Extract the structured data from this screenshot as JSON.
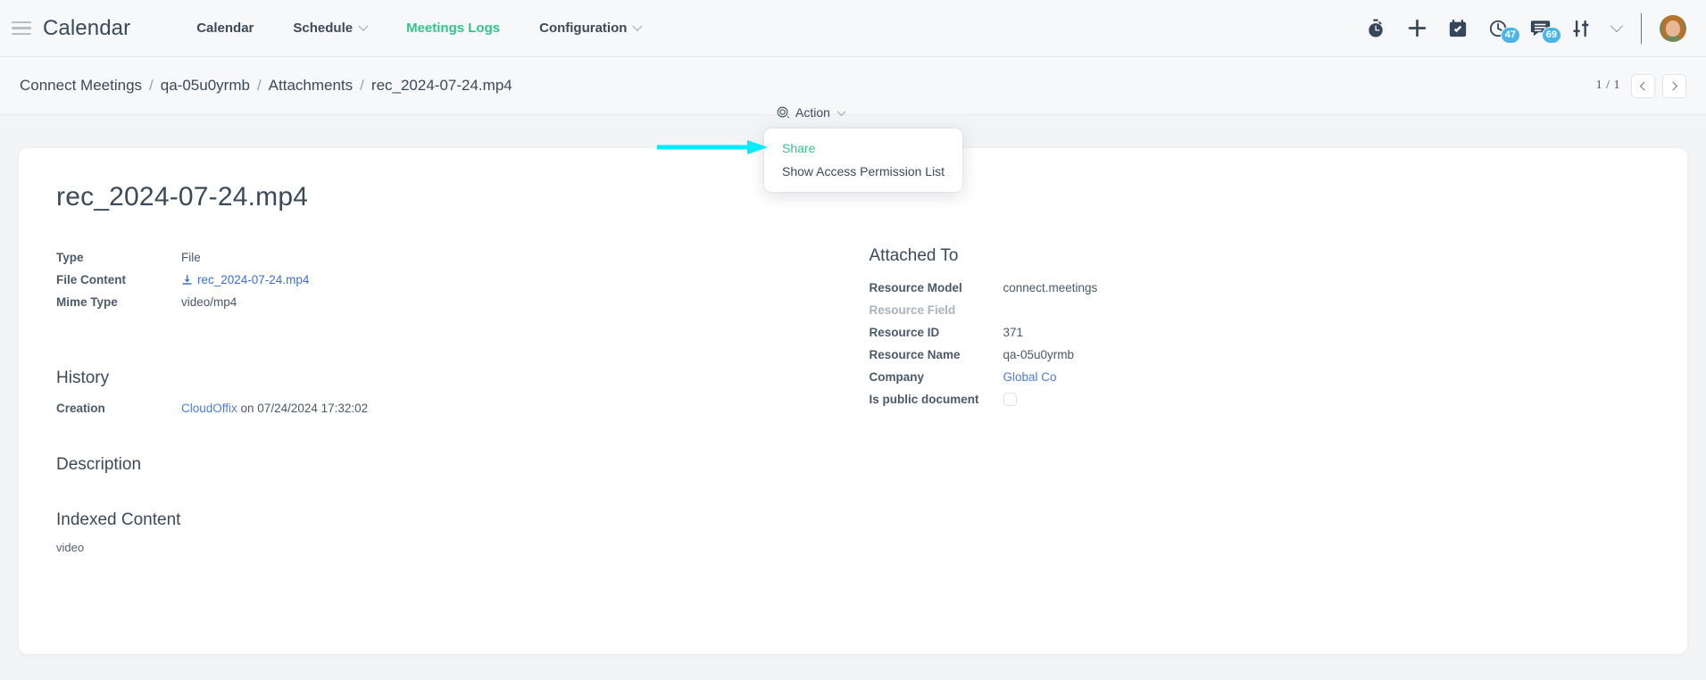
{
  "topbar": {
    "menu_icon": "hamburger-icon",
    "brand": "Calendar",
    "menu": [
      {
        "label": "Calendar",
        "has_caret": false,
        "active": false
      },
      {
        "label": "Schedule",
        "has_caret": true,
        "active": false
      },
      {
        "label": "Meetings Logs",
        "has_caret": false,
        "active": true
      },
      {
        "label": "Configuration",
        "has_caret": true,
        "active": false
      }
    ],
    "icons": [
      {
        "name": "stopwatch-icon",
        "badge": null
      },
      {
        "name": "plus-icon",
        "badge": null
      },
      {
        "name": "calendar-check-icon",
        "badge": null
      },
      {
        "name": "clock-activity-icon",
        "badge": "47"
      },
      {
        "name": "messages-icon",
        "badge": "69"
      },
      {
        "name": "sliders-icon",
        "badge": null
      }
    ],
    "chevron": "chevron-down-icon",
    "avatar": "user-avatar",
    "accent_color": "#31c48d",
    "badge_color": "#49b7e5"
  },
  "breadcrumb": {
    "items": [
      "Connect Meetings",
      "qa-05u0yrmb",
      "Attachments",
      "rec_2024-07-24.mp4"
    ],
    "separator": "/"
  },
  "pager": {
    "count": "1 / 1",
    "prev_icon": "chevron-left-icon",
    "next_icon": "chevron-right-icon"
  },
  "action": {
    "icon": "action-gear-icon",
    "label": "Action",
    "caret": "chevron-down-icon",
    "menu": [
      {
        "label": "Share",
        "highlighted": true
      },
      {
        "label": "Show Access Permission List",
        "highlighted": false
      }
    ]
  },
  "annotation": {
    "arrow_color": "#00ecff",
    "points_to": "Share"
  },
  "document": {
    "title": "rec_2024-07-24.mp4",
    "fields": [
      {
        "label": "Type",
        "value": "File",
        "kind": "text"
      },
      {
        "label": "File Content",
        "value": "rec_2024-07-24.mp4",
        "kind": "download-link"
      },
      {
        "label": "Mime Type",
        "value": "video/mp4",
        "kind": "text"
      }
    ]
  },
  "attached_to": {
    "title": "Attached To",
    "fields": [
      {
        "label": "Resource Model",
        "value": "connect.meetings",
        "kind": "text"
      },
      {
        "label": "Resource Field",
        "value": "",
        "kind": "empty"
      },
      {
        "label": "Resource ID",
        "value": "371",
        "kind": "text"
      },
      {
        "label": "Resource Name",
        "value": "qa-05u0yrmb",
        "kind": "text"
      },
      {
        "label": "Company",
        "value": "Global Co",
        "kind": "link"
      },
      {
        "label": "Is public document",
        "value": "",
        "kind": "checkbox",
        "checked": false
      }
    ]
  },
  "history": {
    "title": "History",
    "label": "Creation",
    "author": "CloudOffix",
    "rest": " on 07/24/2024 17:32:02"
  },
  "description": {
    "title": "Description",
    "body": ""
  },
  "indexed_content": {
    "title": "Indexed Content",
    "body": "video"
  }
}
